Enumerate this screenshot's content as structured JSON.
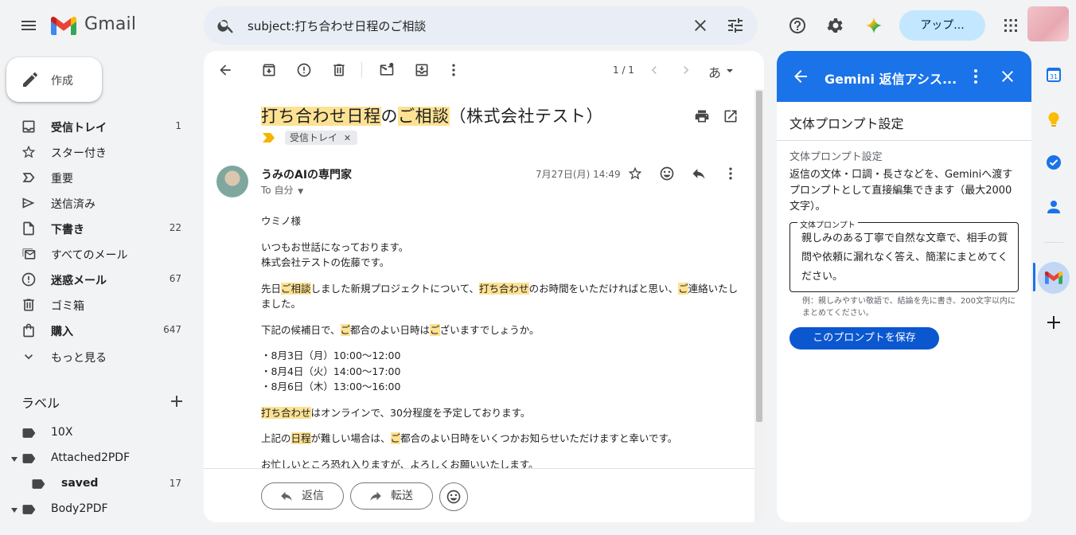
{
  "header": {
    "app_name": "Gmail",
    "search_value": "subject:打ち合わせ日程のご相談",
    "upgrade_label": "アップ..."
  },
  "sidebar": {
    "compose_label": "作成",
    "items": [
      {
        "label": "受信トレイ",
        "count": "1",
        "bold": true
      },
      {
        "label": "スター付き",
        "count": ""
      },
      {
        "label": "重要",
        "count": ""
      },
      {
        "label": "送信済み",
        "count": ""
      },
      {
        "label": "下書き",
        "count": "22",
        "bold": true
      },
      {
        "label": "すべてのメール",
        "count": ""
      },
      {
        "label": "迷惑メール",
        "count": "67",
        "bold": true
      },
      {
        "label": "ゴミ箱",
        "count": ""
      },
      {
        "label": "購入",
        "count": "647",
        "bold": true
      },
      {
        "label": "もっと見る",
        "count": ""
      }
    ],
    "labels_heading": "ラベル",
    "labels": [
      {
        "label": "10X",
        "count": ""
      },
      {
        "label": "Attached2PDF",
        "count": ""
      },
      {
        "label": "saved",
        "count": "17",
        "bold": true
      },
      {
        "label": "Body2PDF",
        "count": ""
      }
    ]
  },
  "toolbar": {
    "pagination": "1 / 1",
    "input_method": "あ"
  },
  "email": {
    "subject_parts": {
      "p1": "打ち合わせ日程",
      "p2": "の",
      "p3": "ご相談",
      "p4": "（株式会社テスト）"
    },
    "label_chip": "受信トレイ",
    "sender": "うみのAIの専門家",
    "to": "To 自分",
    "date": "7月27日(月) 14:49",
    "body": {
      "greeting": "ウミノ様",
      "l2a": "いつもお世話になっております。",
      "l2b": "株式会社テストの佐藤です。",
      "l3": {
        "a": "先日",
        "b": "ご相談",
        "c": "しました新規プロジェクトについて、",
        "d": "打ち合わせ",
        "e": "のお時間をいただければと思い、",
        "f": "ご",
        "g": "連絡いたしました。"
      },
      "l4": {
        "a": "下記の候補日で、",
        "b": "ご",
        "c": "都合のよい日時は",
        "d": "ご",
        "e": "ざいますでしょうか。"
      },
      "slots": [
        "・8月3日（月）10:00〜12:00",
        "・8月4日（火）14:00〜17:00",
        "・8月6日（木）13:00〜16:00"
      ],
      "l5": {
        "a": "打ち合わせ",
        "b": "はオンラインで、30分程度を予定しております。"
      },
      "l6": {
        "a": "上記の",
        "b": "日程",
        "c": "が難しい場合は、",
        "d": "ご",
        "e": "都合のよい日時をいくつかお知らせいただけますと幸いです。"
      },
      "l7": "お忙しいところ恐れ入りますが、よろしくお願いいたします。"
    },
    "reply_label": "返信",
    "forward_label": "転送"
  },
  "gemini": {
    "title": "Gemini 返信アシス...",
    "subheader": "文体プロンプト設定",
    "section_label": "文体プロンプト設定",
    "description": "返信の文体・口調・長さなどを、Geminiへ渡すプロンプトとして直接編集できます（最大2000文字）。",
    "field_label": "文体プロンプト",
    "field_value": "親しみのある丁寧で自然な文章で、相手の質問や依頼に漏れなく答え、簡潔にまとめてください。",
    "hint": "例：親しみやすい敬語で、結論を先に書き、200文字以内にまとめてください。",
    "save_label": "このプロンプトを保存"
  },
  "colors": {
    "accent": "#1a73e8",
    "highlight": "#fde293",
    "upgrade_bg": "#c2e7ff"
  }
}
